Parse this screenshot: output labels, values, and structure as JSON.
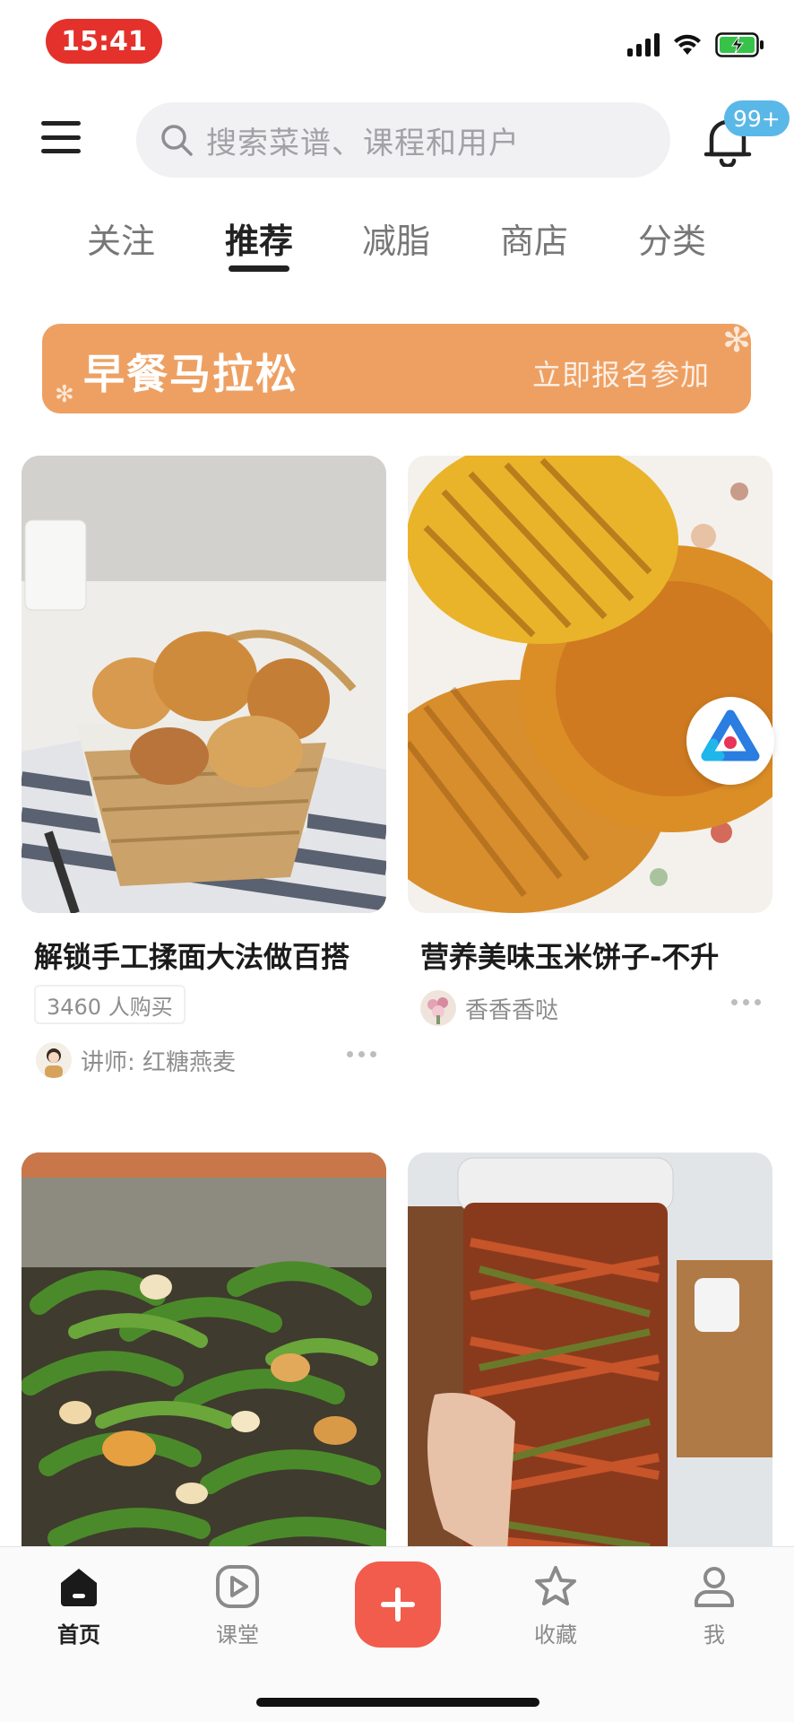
{
  "status_bar": {
    "time": "15:41"
  },
  "header": {
    "search_placeholder": "搜索菜谱、课程和用户",
    "notification_badge": "99+"
  },
  "tabs": [
    {
      "label": "关注",
      "active": false
    },
    {
      "label": "推荐",
      "active": true
    },
    {
      "label": "减脂",
      "active": false
    },
    {
      "label": "商店",
      "active": false
    },
    {
      "label": "分类",
      "active": false
    }
  ],
  "banner": {
    "title": "早餐马拉松",
    "cta": "立即报名参加"
  },
  "feed": [
    {
      "title": "解锁手工揉面大法做百搭",
      "purchases": "3460 人购买",
      "author": "讲师: 红糖燕麦"
    },
    {
      "title": "营养美味玉米饼子-不升",
      "author": "香香香哒"
    },
    {
      "title": ""
    },
    {
      "title": ""
    }
  ],
  "bottom_nav": [
    {
      "label": "首页",
      "icon": "home-icon",
      "active": true
    },
    {
      "label": "课堂",
      "icon": "play-icon",
      "active": false
    },
    {
      "label": "收藏",
      "icon": "star-icon",
      "active": false
    },
    {
      "label": "我",
      "icon": "user-icon",
      "active": false
    }
  ],
  "colors": {
    "accent_red": "#f25c4c",
    "banner_orange": "#eea062",
    "badge_blue": "#5ab8e8",
    "time_pill_red": "#e5312b"
  }
}
